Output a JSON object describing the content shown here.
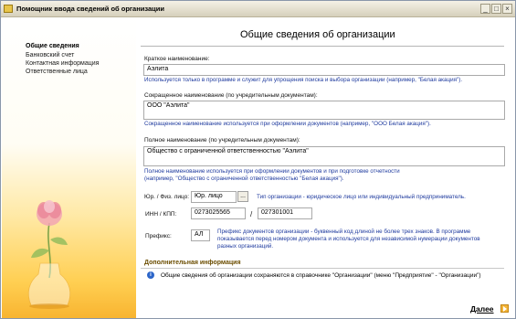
{
  "window": {
    "title": "Помощник ввода сведений об организации",
    "min_glyph": "_",
    "max_glyph": "□",
    "close_glyph": "×"
  },
  "nav": {
    "items": [
      "Общие сведения",
      "Банковский счет",
      "Контактная информация",
      "Ответственные лица"
    ]
  },
  "page_title": "Общие сведения об организации",
  "short_name": {
    "label": "Краткое наименование:",
    "value": "Аэлита",
    "hint": "Используется только в программе и служит для упрощения поиска и выбора организации (например, \"Белая акация\")."
  },
  "abbr_name": {
    "label": "Сокращенное наименование (по учредительным документам):",
    "value": "ООО \"Аэлита\"",
    "hint": "Сокращенное наименование используется при оформлении документов (например, \"ООО Белая акация\")."
  },
  "full_name": {
    "label": "Полное наименование (по учредительным документам):",
    "value": "Общество с ограниченной ответственностью \"Аэлита\"",
    "hint_1": "Полное наименование используется при оформлении документов и при подготовке отчетности",
    "hint_2": "(например, \"Общество с ограниченной ответственностью \"Белая акация\")."
  },
  "entity_type": {
    "label": "Юр. / Физ. лицо:",
    "value": "Юр. лицо",
    "button": "...",
    "hint": "Тип организации - юридическое лицо или индивидуальный предприниматель."
  },
  "inn_kpp": {
    "label": "ИНН / КПП:",
    "inn": "0273025565",
    "separator": "/",
    "kpp": "027301001"
  },
  "prefix": {
    "label": "Префикс:",
    "value": "АЛ",
    "hint_1": "Префикс документов организации - буквенный код длиной не более трех знаков. В программе",
    "hint_2": "показывается перед номером документа и используется для независимой нумерации документов",
    "hint_3": "разных организаций."
  },
  "extra": {
    "title": "Дополнительная информация",
    "info": "Общие сведения об организации сохраняются в справочнике \"Организации\" (меню \"Предприятие\" - \"Организации\")"
  },
  "next_button": {
    "label": "Далее"
  }
}
